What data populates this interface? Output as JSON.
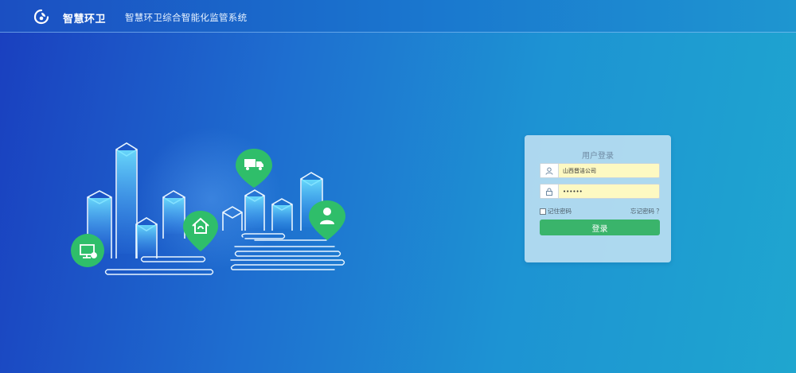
{
  "header": {
    "brand": "智慧环卫",
    "system_title": "智慧环卫综合智能化监管系统"
  },
  "login": {
    "title": "用户登录",
    "username_value": "山西晋洁公司",
    "password_value": "••••••",
    "remember_label": "记住密码",
    "forgot_label": "忘记密码 ？",
    "submit_label": "登录"
  },
  "icons": {
    "logo": "leaf-circle-logo-icon",
    "user": "user-icon",
    "lock": "lock-icon",
    "truck": "truck-icon",
    "house": "house-icon",
    "monitor": "monitor-icon",
    "worker": "worker-icon"
  },
  "colors": {
    "accent_green": "#3ab46b",
    "marker_green": "#2fbe6a",
    "input_fill": "#fdf9c2"
  }
}
